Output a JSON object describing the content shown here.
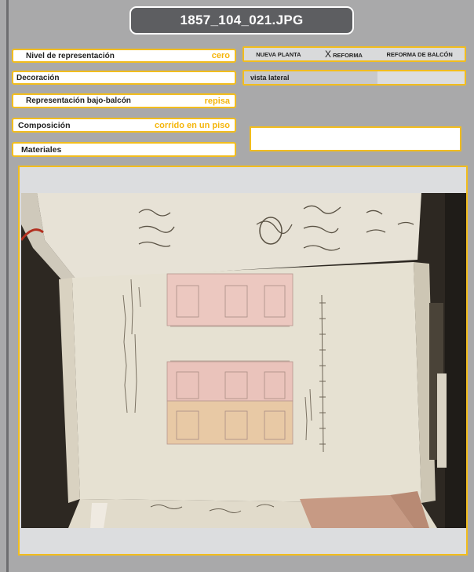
{
  "title": "1857_104_021.JPG",
  "fields": {
    "nivel": {
      "label": "Nivel de representación",
      "value": "cero"
    },
    "decoracion": {
      "label": "Decoración",
      "value": ""
    },
    "bajo_balcon": {
      "label": "Representación bajo-balcón",
      "value": "repisa"
    },
    "composicion": {
      "label": "Composición",
      "value": "corrido en un piso"
    },
    "materiales": {
      "label": "Materiales",
      "value": ""
    }
  },
  "tags": {
    "nueva_planta": "NUEVA PLANTA",
    "reforma_mark": "X",
    "reforma": "REFORMA",
    "reforma_balcon": "REFORMA DE  BALCÓN"
  },
  "view": "vista lateral",
  "colors": {
    "accent": "#f2bd1d",
    "value_text": "#f5b50a",
    "title_bg": "#5d5e61",
    "page_bg": "#a9a9aa"
  }
}
